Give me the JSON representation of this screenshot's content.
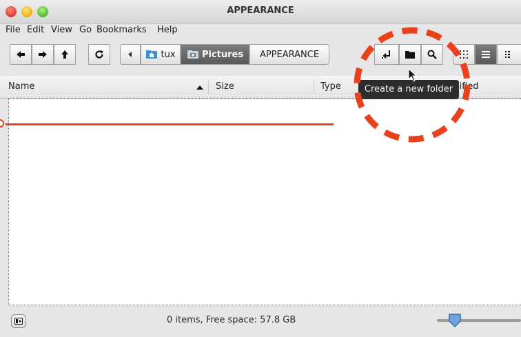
{
  "window": {
    "title": "APPEARANCE"
  },
  "menubar": {
    "items": [
      "File",
      "Edit",
      "View",
      "Go",
      "Bookmarks",
      "Help"
    ]
  },
  "toolbar": {
    "back_icon": "arrow-left-icon",
    "forward_icon": "arrow-right-icon",
    "up_icon": "arrow-up-icon",
    "reload_icon": "reload-icon",
    "breadcrumb": [
      "tux",
      "Pictures",
      "APPEARANCE"
    ],
    "active_crumb": "Pictures",
    "open_terminal_icon": "open-terminal-icon",
    "new_folder_icon": "folder-icon",
    "search_icon": "search-icon",
    "view_icons_icon": "grid-icon",
    "view_list_icon": "list-icon",
    "view_compact_icon": "compact-icon"
  },
  "columns": [
    "Name",
    "Size",
    "Type",
    "Date Modified"
  ],
  "sort": {
    "column": "Name",
    "direction": "ascending"
  },
  "tooltip": "Create a new folder",
  "status": {
    "text": "0 items, Free space: 57.8 GB",
    "zoom_level": 0.6
  },
  "colors": {
    "annotation": "#e8411c",
    "active_crumb": "#666666",
    "tooltip_bg": "#2d2d2d"
  }
}
